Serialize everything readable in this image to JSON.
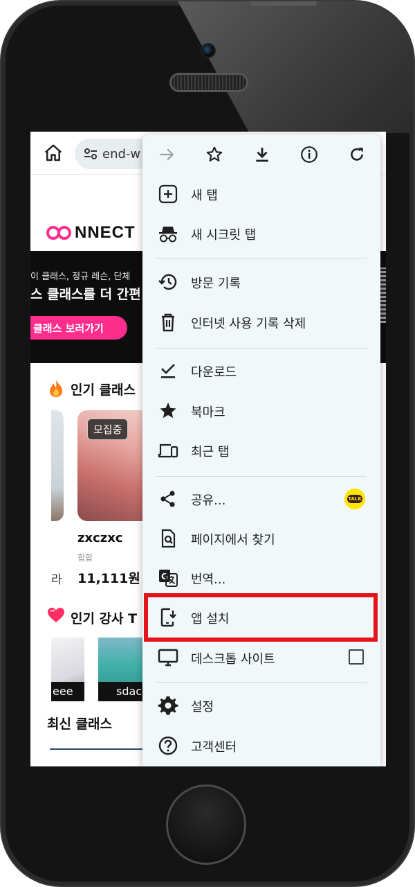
{
  "browser": {
    "url_text": "end-w",
    "menu": {
      "toolbar": [
        {
          "icon": "forward-arrow-icon"
        },
        {
          "icon": "star-icon"
        },
        {
          "icon": "download-icon"
        },
        {
          "icon": "info-icon"
        },
        {
          "icon": "refresh-icon"
        }
      ],
      "items": {
        "new_tab": "새 탭",
        "incognito": "새 시크릿 탭",
        "history": "방문 기록",
        "clear_data": "인터넷 사용 기록 삭제",
        "downloads": "다운로드",
        "bookmarks": "북마크",
        "recent_tabs": "최근 탭",
        "share": "공유...",
        "find_in_page": "페이지에서 찾기",
        "translate": "번역...",
        "install_app": "앱 설치",
        "desktop_site": "데스크톱 사이트",
        "settings": "설정",
        "help": "고객센터"
      },
      "share_badge": "TALK",
      "highlight_color": "#e5141b"
    }
  },
  "page": {
    "logo_rest": "NNECT",
    "banner": {
      "line1": "이 클래스, 정규 레슨, 단체",
      "line2": "스 클래스를 더 간편",
      "cta": "클래스 보러가기"
    },
    "popular_classes_title": "인기 클래스",
    "class_card": {
      "badge": "모집중",
      "name": "zxczxc",
      "category": "힙합",
      "price": "11,111원",
      "left_price_fragment": "라"
    },
    "popular_instructors_title": "인기 강사 T",
    "instructors": [
      {
        "name": "eee"
      },
      {
        "name": "sdac"
      }
    ],
    "latest_classes_title": "최신 클래스"
  },
  "colors": {
    "accent": "#ff2d8c",
    "menu_bg": "#f1f8f9"
  }
}
